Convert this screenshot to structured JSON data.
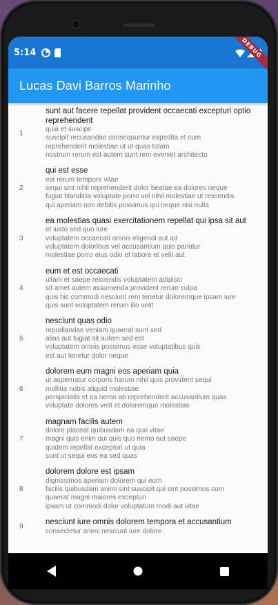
{
  "status": {
    "time": "5:14",
    "debug_label": "DEBUG"
  },
  "appbar": {
    "title": "Lucas Davi Barros Marinho"
  },
  "posts": [
    {
      "id": "1",
      "title": "sunt aut facere repellat provident occaecati excepturi optio reprehenderit",
      "body": "quia et suscipit\nsuscipit recusandae consequuntur expedita et cum\nreprehenderit molestiae ut ut quas totam\nnostrum rerum est autem sunt rem eveniet architecto"
    },
    {
      "id": "2",
      "title": "qui est esse",
      "body": "est rerum tempore vitae\nsequi sint nihil reprehenderit dolor beatae ea dolores neque\nfugiat blanditiis voluptate porro vel nihil molestiae ut reiciendis\nqui aperiam non debitis possimus qui neque nisi nulla"
    },
    {
      "id": "3",
      "title": "ea molestias quasi exercitationem repellat qui ipsa sit aut",
      "body": "et iusto sed quo iure\nvoluptatem occaecati omnis eligendi aut ad\nvoluptatem doloribus vel accusantium quis pariatur\nmolestiae porro eius odio et labore et velit aut"
    },
    {
      "id": "4",
      "title": "eum et est occaecati",
      "body": "ullam et saepe reiciendis voluptatem adipisci\nsit amet autem assumenda provident rerum culpa\nquis hic commodi nesciunt rem tenetur doloremque ipsam iure\nquis sunt voluptatem rerum illo velit"
    },
    {
      "id": "5",
      "title": "nesciunt quas odio",
      "body": "repudiandae veniam quaerat sunt sed\nalias aut fugiat sit autem sed est\nvoluptatem omnis possimus esse voluptatibus quis\nest aut tenetur dolor neque"
    },
    {
      "id": "6",
      "title": "dolorem eum magni eos aperiam quia",
      "body": "ut aspernatur corporis harum nihil quis provident sequi\nmollitia nobis aliquid molestiae\nperspiciatis et ea nemo ab reprehenderit accusantium quas\nvoluptate dolores velit et doloremque molestiae"
    },
    {
      "id": "7",
      "title": "magnam facilis autem",
      "body": "dolore placeat quibusdam ea quo vitae\nmagni quis enim qui quis quo nemo aut saepe\nquidem repellat excepturi ut quia\nsunt ut sequi eos ea sed quas"
    },
    {
      "id": "8",
      "title": "dolorem dolore est ipsam",
      "body": "dignissimos aperiam dolorem qui eum\nfacilis quibusdam animi sint suscipit qui sint possimus cum\nquaerat magni maiores excepturi\nipsam ut commodi dolor voluptatum modi aut vitae"
    },
    {
      "id": "9",
      "title": "nesciunt iure omnis dolorem tempora et accusantium",
      "body": "consectetur animi nesciunt iure dolore"
    }
  ],
  "icons": {
    "back": "back-triangle-icon",
    "home": "home-circle-icon",
    "recents": "recents-square-icon"
  }
}
